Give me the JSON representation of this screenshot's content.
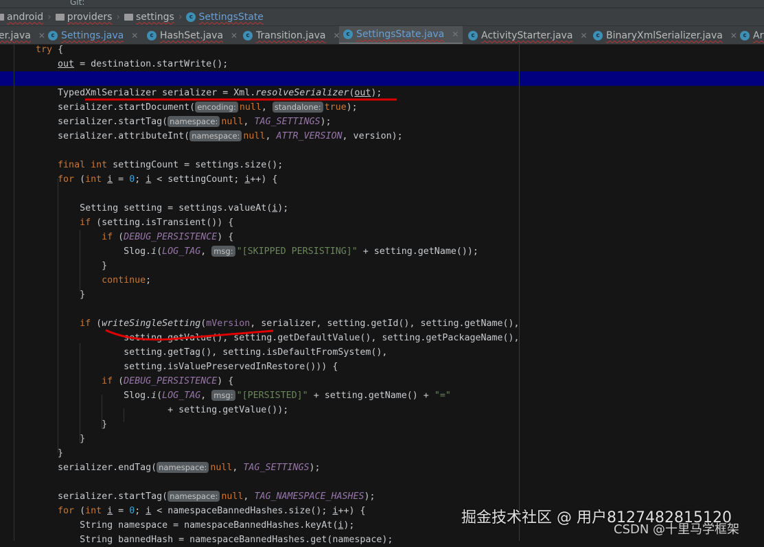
{
  "toolbar": {
    "vcs_label": "Git:"
  },
  "breadcrumb": [
    "android",
    "providers",
    "settings",
    "SettingsState"
  ],
  "tabs": [
    {
      "label": "er.java",
      "active": false
    },
    {
      "label": "Settings.java",
      "active": false
    },
    {
      "label": "HashSet.java",
      "active": false
    },
    {
      "label": "Transition.java",
      "active": false
    },
    {
      "label": "SettingsState.java",
      "active": true
    },
    {
      "label": "ActivityStarter.java",
      "active": false
    },
    {
      "label": "BinaryXmlSerializer.java",
      "active": false
    },
    {
      "label": "Art",
      "active": false
    }
  ],
  "code": [
    [
      [
        "p",
        "    "
      ],
      [
        "kw",
        "try"
      ],
      [
        "p",
        " {"
      ]
    ],
    [
      [
        "p",
        "        "
      ],
      [
        "ul",
        "out"
      ],
      [
        "p",
        " = destination.startWrite();"
      ]
    ],
    [],
    [
      [
        "p",
        "        TypedXmlSerializer serializer = Xml."
      ],
      [
        "meth",
        "resolveSerializer"
      ],
      [
        "p",
        "("
      ],
      [
        "ul",
        "out"
      ],
      [
        "p",
        ");"
      ]
    ],
    [
      [
        "p",
        "        serializer.startDocument("
      ],
      [
        "hint",
        "encoding:"
      ],
      [
        "kw",
        "null"
      ],
      [
        "p",
        ", "
      ],
      [
        "hint",
        "standalone:"
      ],
      [
        "kw",
        "true"
      ],
      [
        "p",
        ");"
      ]
    ],
    [
      [
        "p",
        "        serializer.startTag("
      ],
      [
        "hint",
        "namespace:"
      ],
      [
        "kw",
        "null"
      ],
      [
        "p",
        ", "
      ],
      [
        "const",
        "TAG_SETTINGS"
      ],
      [
        "p",
        ");"
      ]
    ],
    [
      [
        "p",
        "        serializer.attributeInt("
      ],
      [
        "hint",
        "namespace:"
      ],
      [
        "kw",
        "null"
      ],
      [
        "p",
        ", "
      ],
      [
        "const",
        "ATTR_VERSION"
      ],
      [
        "p",
        ", version);"
      ]
    ],
    [],
    [
      [
        "p",
        "        "
      ],
      [
        "kw",
        "final int"
      ],
      [
        "p",
        " settingCount = settings.size();"
      ]
    ],
    [
      [
        "p",
        "        "
      ],
      [
        "kw",
        "for"
      ],
      [
        "p",
        " ("
      ],
      [
        "kw",
        "int"
      ],
      [
        "p",
        " "
      ],
      [
        "ul",
        "i"
      ],
      [
        "p",
        " = "
      ],
      [
        "num",
        "0"
      ],
      [
        "p",
        "; "
      ],
      [
        "ul",
        "i"
      ],
      [
        "p",
        " < settingCount; "
      ],
      [
        "ul",
        "i"
      ],
      [
        "p",
        "++) {"
      ]
    ],
    [],
    [
      [
        "p",
        "            Setting setting = settings.valueAt("
      ],
      [
        "ul",
        "i"
      ],
      [
        "p",
        ");"
      ]
    ],
    [
      [
        "p",
        "            "
      ],
      [
        "kw",
        "if"
      ],
      [
        "p",
        " (setting.isTransient()) {"
      ]
    ],
    [
      [
        "p",
        "                "
      ],
      [
        "kw",
        "if"
      ],
      [
        "p",
        " ("
      ],
      [
        "const",
        "DEBUG_PERSISTENCE"
      ],
      [
        "p",
        ") {"
      ]
    ],
    [
      [
        "p",
        "                    Slog."
      ],
      [
        "meth",
        "i"
      ],
      [
        "p",
        "("
      ],
      [
        "const",
        "LOG_TAG"
      ],
      [
        "p",
        ", "
      ],
      [
        "hint",
        "msg:"
      ],
      [
        "str",
        "\"[SKIPPED PERSISTING]\""
      ],
      [
        "p",
        " + setting.getName());"
      ]
    ],
    [
      [
        "p",
        "                }"
      ]
    ],
    [
      [
        "p",
        "                "
      ],
      [
        "kw",
        "continue"
      ],
      [
        "p",
        ";"
      ]
    ],
    [
      [
        "p",
        "            }"
      ]
    ],
    [],
    [
      [
        "p",
        "            "
      ],
      [
        "kw",
        "if"
      ],
      [
        "p",
        " ("
      ],
      [
        "meth",
        "writeSingleSetting"
      ],
      [
        "p",
        "("
      ],
      [
        "field",
        "mVersion"
      ],
      [
        "p",
        ", serializer, setting.getId(), setting.getName(),"
      ]
    ],
    [
      [
        "p",
        "                    setting.getValue(), setting.getDefaultValue(), setting.getPackageName(),"
      ]
    ],
    [
      [
        "p",
        "                    setting.getTag(), setting.isDefaultFromSystem(),"
      ]
    ],
    [
      [
        "p",
        "                    setting.isValuePreservedInRestore())) {"
      ]
    ],
    [
      [
        "p",
        "                "
      ],
      [
        "kw",
        "if"
      ],
      [
        "p",
        " ("
      ],
      [
        "const",
        "DEBUG_PERSISTENCE"
      ],
      [
        "p",
        ") {"
      ]
    ],
    [
      [
        "p",
        "                    Slog."
      ],
      [
        "meth",
        "i"
      ],
      [
        "p",
        "("
      ],
      [
        "const",
        "LOG_TAG"
      ],
      [
        "p",
        ", "
      ],
      [
        "hint",
        "msg:"
      ],
      [
        "str",
        "\"[PERSISTED]\""
      ],
      [
        "p",
        " + setting.getName() + "
      ],
      [
        "str",
        "\"=\""
      ]
    ],
    [
      [
        "p",
        "                            + setting.getValue());"
      ]
    ],
    [
      [
        "p",
        "                }"
      ]
    ],
    [
      [
        "p",
        "            }"
      ]
    ],
    [
      [
        "p",
        "        }"
      ]
    ],
    [
      [
        "p",
        "        serializer.endTag("
      ],
      [
        "hint",
        "namespace:"
      ],
      [
        "kw",
        "null"
      ],
      [
        "p",
        ", "
      ],
      [
        "const",
        "TAG_SETTINGS"
      ],
      [
        "p",
        ");"
      ]
    ],
    [],
    [
      [
        "p",
        "        serializer.startTag("
      ],
      [
        "hint",
        "namespace:"
      ],
      [
        "kw",
        "null"
      ],
      [
        "p",
        ", "
      ],
      [
        "const",
        "TAG_NAMESPACE_HASHES"
      ],
      [
        "p",
        ");"
      ]
    ],
    [
      [
        "p",
        "        "
      ],
      [
        "kw",
        "for"
      ],
      [
        "p",
        " ("
      ],
      [
        "kw",
        "int"
      ],
      [
        "p",
        " "
      ],
      [
        "ul",
        "i"
      ],
      [
        "p",
        " = "
      ],
      [
        "num",
        "0"
      ],
      [
        "p",
        "; "
      ],
      [
        "ul",
        "i"
      ],
      [
        "p",
        " < namespaceBannedHashes.size(); "
      ],
      [
        "ul",
        "i"
      ],
      [
        "p",
        "++) {"
      ]
    ],
    [
      [
        "p",
        "            String namespace = namespaceBannedHashes.keyAt("
      ],
      [
        "ul",
        "i"
      ],
      [
        "p",
        ");"
      ]
    ],
    [
      [
        "p",
        "            String bannedHash = namespaceBannedHashes.get(namespace);"
      ]
    ]
  ],
  "watermark": {
    "line1": "掘金技术社区 @ 用户8127482815120",
    "line2": "CSDN @十里马学框架"
  },
  "colors": {
    "keyword": "#cc7832",
    "constant": "#9876aa",
    "string": "#6a8759",
    "annotation": "#e00000",
    "caret_line": "#010180"
  }
}
